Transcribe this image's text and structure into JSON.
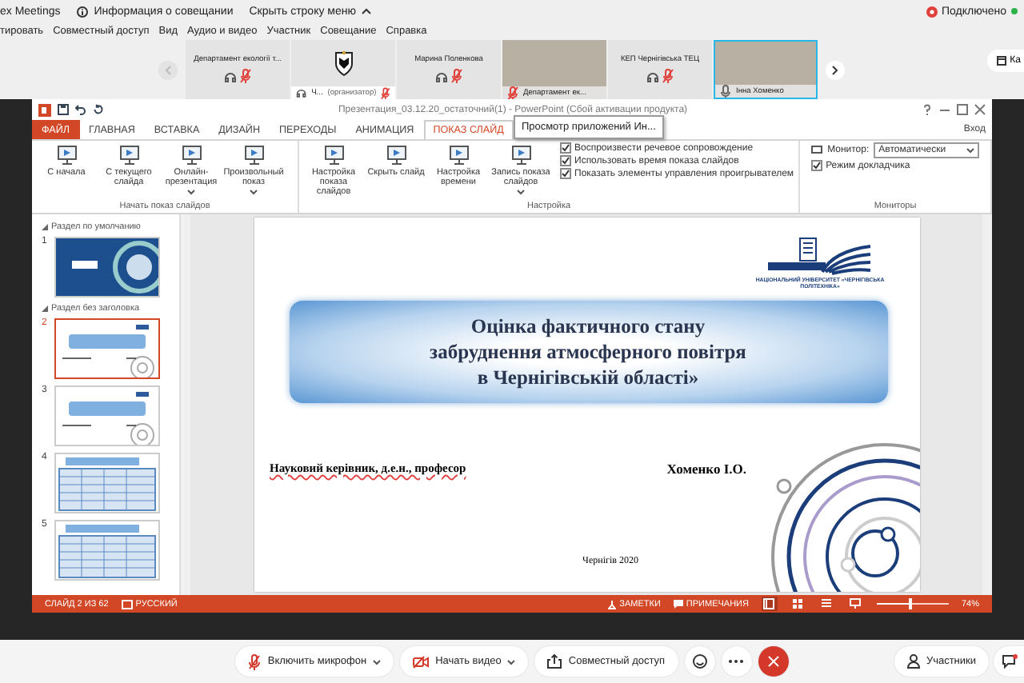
{
  "app_bar": {
    "title": "ex Meetings",
    "info": "Информация о совещании",
    "hide_menu": "Скрыть строку меню",
    "status": "Подключено"
  },
  "menu": [
    "тировать",
    "Совместный доступ",
    "Вид",
    "Аудио и видео",
    "Участник",
    "Совещание",
    "Справка"
  ],
  "participants": [
    {
      "kind": "name",
      "name": "Департамент екології т...",
      "muted": true,
      "selected": false
    },
    {
      "kind": "logo",
      "name": "Ч...",
      "role": "(организатор)",
      "muted": true,
      "selected": false
    },
    {
      "kind": "name",
      "name": "Марина Поленкова",
      "muted": true,
      "selected": false
    },
    {
      "kind": "video",
      "name": "Департамент ек...",
      "muted": true,
      "selected": false
    },
    {
      "kind": "name",
      "name": "КЕП Чернігівська ТЕЦ",
      "muted": true,
      "selected": false
    },
    {
      "kind": "video",
      "name": "Інна Хоменко",
      "muted": false,
      "selected": true
    }
  ],
  "side_button": "Ка",
  "powerpoint": {
    "title": "Презентация_03.12.20_остаточний(1) - PowerPoint (Сбой активации продукта)",
    "tooltip": "Просмотр приложений Ин...",
    "sign_in": "Вход",
    "tabs": [
      {
        "label": "ФАЙЛ",
        "kind": "file",
        "selected": false
      },
      {
        "label": "ГЛАВНАЯ",
        "kind": "tab",
        "selected": false
      },
      {
        "label": "ВСТАВКА",
        "kind": "tab",
        "selected": false
      },
      {
        "label": "ДИЗАЙН",
        "kind": "tab",
        "selected": false
      },
      {
        "label": "ПЕРЕХОДЫ",
        "kind": "tab",
        "selected": false
      },
      {
        "label": "АНИМАЦИЯ",
        "kind": "tab",
        "selected": false
      },
      {
        "label": "ПОКАЗ СЛАЙД",
        "kind": "tab",
        "selected": true
      }
    ],
    "ribbon": [
      {
        "label": "Начать показ слайдов",
        "buttons": [
          {
            "label": "С начала",
            "dropdown": false
          },
          {
            "label": "С текущего слайда",
            "dropdown": false
          },
          {
            "label": "Онлайн-презентация",
            "dropdown": true
          },
          {
            "label": "Произвольный показ",
            "dropdown": true
          }
        ]
      },
      {
        "label": "Настройка",
        "buttons": [
          {
            "label": "Настройка показа слайдов",
            "dropdown": false
          },
          {
            "label": "Скрыть слайд",
            "dropdown": false
          },
          {
            "label": "Настройка времени",
            "dropdown": false
          },
          {
            "label": "Запись показа слайдов",
            "dropdown": true
          }
        ],
        "checkboxes": [
          {
            "label": "Воспроизвести речевое сопровождение",
            "checked": true
          },
          {
            "label": "Использовать время показа слайдов",
            "checked": true
          },
          {
            "label": "Показать элементы управления проигрывателем",
            "checked": true
          }
        ]
      },
      {
        "label": "Мониторы",
        "monitor": {
          "label": "Монитор:",
          "value": "Автоматически"
        },
        "checkboxes": [
          {
            "label": "Режим докладчика",
            "checked": true
          }
        ]
      }
    ],
    "sections": [
      {
        "label": "Раздел по умолчанию",
        "slides": [
          {
            "number": "1",
            "kind": "cover",
            "selected": false
          }
        ]
      },
      {
        "label": "Раздел без заголовка",
        "slides": [
          {
            "number": "2",
            "kind": "title",
            "selected": true
          },
          {
            "number": "3",
            "kind": "title",
            "selected": false
          },
          {
            "number": "4",
            "kind": "table",
            "selected": false
          },
          {
            "number": "5",
            "kind": "table",
            "selected": false
          }
        ]
      }
    ],
    "slide": {
      "logo_text": "НАЦІОНАЛЬНИЙ УНІВЕРСИТЕТ «ЧЕРНІГІВСЬКА ПОЛІТЕХНІКА»",
      "title": [
        "Оцінка фактичного стану",
        "забруднення атмосферного повітря",
        "в Чернігівській області»"
      ],
      "supervisor": "Науковий керівник, д.е.н., професор",
      "author": "Хоменко І.О.",
      "place": "Чернігів  2020"
    },
    "status_bar": {
      "slide_info": "СЛАЙД 2 ИЗ 62",
      "language": "РУССКИЙ",
      "notes": "ЗАМЕТКИ",
      "comments": "ПРИМЕЧАНИЯ",
      "views": [
        {
          "kind": "normal",
          "selected": true
        },
        {
          "kind": "sorter",
          "selected": false
        },
        {
          "kind": "reading",
          "selected": false
        },
        {
          "kind": "show",
          "selected": false
        }
      ],
      "zoom": {
        "level": 0.45,
        "reading": "74%"
      }
    }
  },
  "controls": [
    {
      "kind": "mic",
      "label": "Включить микрофон",
      "dropdown": true
    },
    {
      "kind": "video",
      "label": "Начать видео",
      "dropdown": true
    },
    {
      "kind": "share",
      "label": "Совместный доступ",
      "dropdown": false
    },
    {
      "kind": "reactions"
    },
    {
      "kind": "more"
    },
    {
      "kind": "leave"
    }
  ],
  "participants_button": "Участники"
}
